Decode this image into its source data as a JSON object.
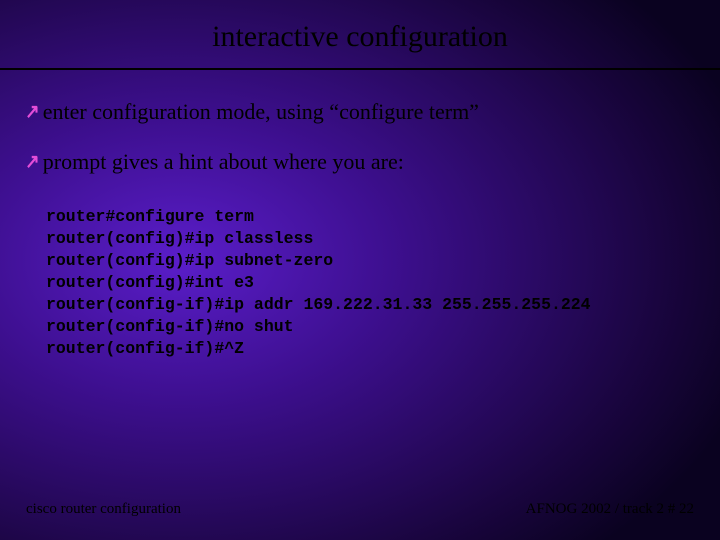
{
  "title": "interactive configuration",
  "bullets": [
    "enter configuration mode, using “configure term”",
    "prompt gives a hint about where you are:"
  ],
  "code_lines": [
    "router#configure term",
    "router(config)#ip classless",
    "router(config)#ip subnet-zero",
    "router(config)#int e3",
    "router(config-if)#ip addr 169.222.31.33 255.255.255.224",
    "router(config-if)#no shut",
    "router(config-if)#^Z"
  ],
  "footer_left": "cisco router configuration",
  "footer_right": "AFNOG 2002 / track 2  # 22"
}
